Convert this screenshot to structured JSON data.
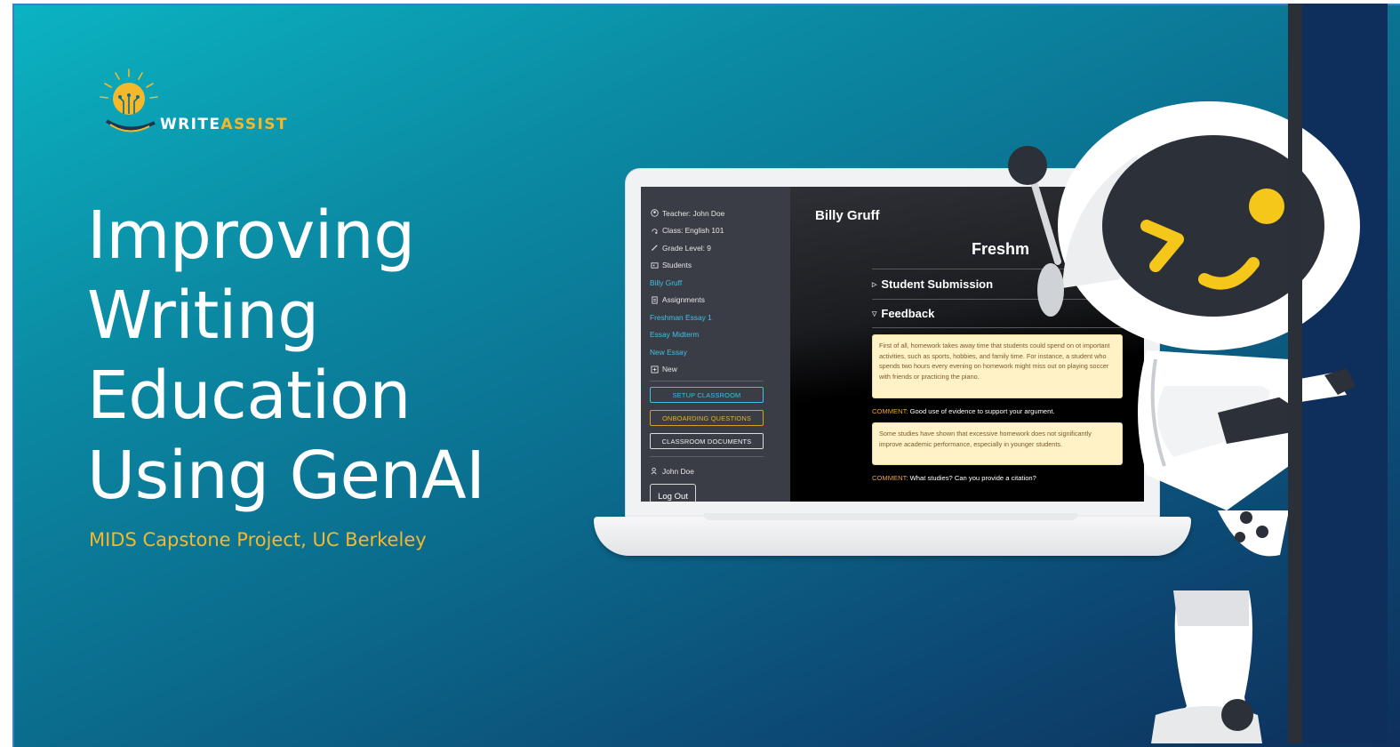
{
  "logo": {
    "brand_part1": "WRITE",
    "brand_part2": "ASSIST",
    "icon": "lightbulb-icon"
  },
  "title": {
    "lines": [
      "Improving",
      "Writing",
      "Education",
      "Using GenAI"
    ]
  },
  "subtitle": "MIDS Capstone Project, UC Berkeley",
  "colors": {
    "accent_yellow": "#f5b82a",
    "link_blue": "#3fc1e6",
    "feedback_bg": "#fff2c6",
    "comment_label": "#f0a22a"
  },
  "app": {
    "sidebar": {
      "teacher": "Teacher: John Doe",
      "class": "Class: English 101",
      "grade": "Grade Level: 9",
      "students_label": "Students",
      "students": [
        "Billy Gruff"
      ],
      "assignments_label": "Assignments",
      "assignments": [
        "Freshman Essay 1",
        "Essay Midterm",
        "New Essay"
      ],
      "new_label": "New",
      "buttons": {
        "setup": "SETUP CLASSROOM",
        "onboarding": "ONBOARDING QUESTIONS",
        "documents": "CLASSROOM DOCUMENTS"
      },
      "user": "John Doe",
      "logout": "Log Out"
    },
    "main": {
      "student_name": "Billy Gruff",
      "assignment_title": "Freshm",
      "sections": {
        "submission": "Student Submission",
        "feedback": "Feedback"
      },
      "feedback_items": [
        {
          "excerpt": "First of all, homework takes away time that students could spend on ot important activities, such as sports, hobbies, and family time. For instance, a student who spends two hours every evening on homework might miss out on playing soccer with friends or practicing the piano.",
          "comment_label": "COMMENT:",
          "comment": "Good use of evidence to support your argument."
        },
        {
          "excerpt": "Some studies have shown that excessive homework does not significantly improve academic performance, especially in younger students.",
          "comment_label": "COMMENT:",
          "comment": "What studies? Can you provide a citation?"
        }
      ]
    }
  }
}
